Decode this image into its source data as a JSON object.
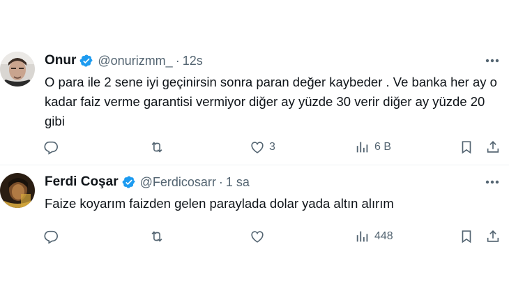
{
  "tweets": [
    {
      "author_name": "Onur",
      "handle": "@onurizmm_",
      "separator": "·",
      "time": "12s",
      "text": "O para ile 2 sene iyi geçinirsin sonra paran değer kaybeder . Ve banka her ay o kadar faiz verme garantisi vermiyor diğer ay yüzde 30 verir diğer ay yüzde 20 gibi",
      "likes": "3",
      "views": "6 B"
    },
    {
      "author_name": "Ferdi Coşar",
      "handle": "@Ferdicosarr",
      "separator": "·",
      "time": "1 sa",
      "text": "Faize koyarım faizden gelen paraylada dolar yada altın alırım",
      "likes": "",
      "views": "448"
    }
  ],
  "colors": {
    "verified": "#1d9bf0",
    "text": "#0f1419",
    "secondary": "#536471",
    "divider": "#eff3f4"
  },
  "icons": [
    "verified-badge-icon",
    "more-icon",
    "reply-icon",
    "retweet-icon",
    "like-icon",
    "views-icon",
    "bookmark-icon",
    "share-icon"
  ]
}
